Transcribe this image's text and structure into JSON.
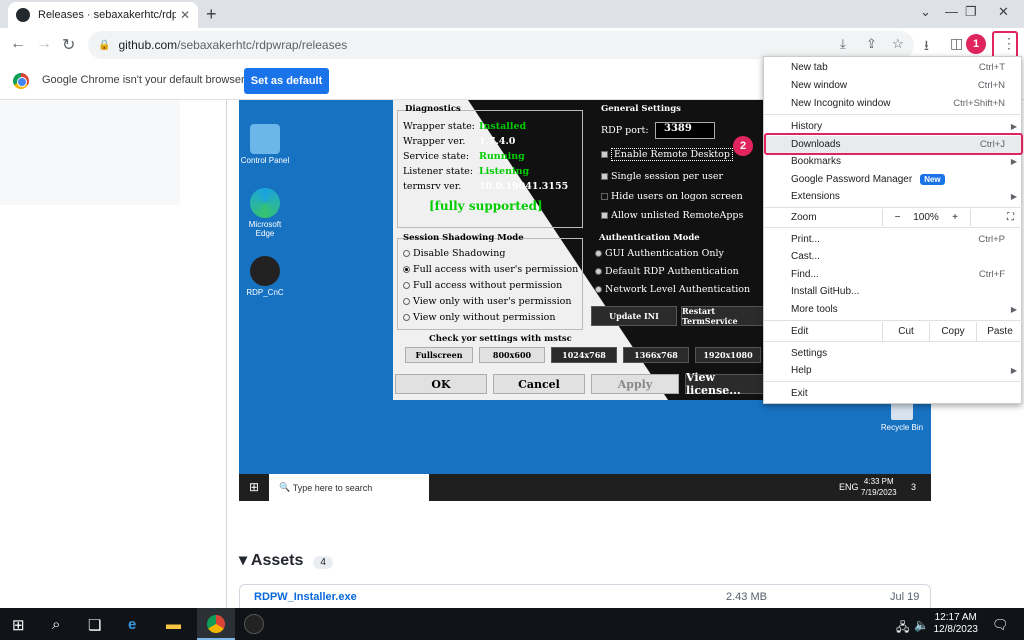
{
  "tab": {
    "title": "Releases · sebaxakerhtc/rdpwrap",
    "close": "✕"
  },
  "omnibox": {
    "host": "github.com",
    "path": "/sebaxakerhtc/rdpwrap/releases"
  },
  "infobar": {
    "message": "Google Chrome isn't your default browser",
    "button": "Set as default"
  },
  "markers": {
    "one": "1",
    "two": "2"
  },
  "desktop": {
    "icons": [
      "Control Panel",
      "Microsoft Edge",
      "RDP_CnC"
    ],
    "recycle": "Recycle Bin",
    "search_placeholder": "Type here to search",
    "lang": "ENG",
    "time": "4:33 PM",
    "date": "7/19/2023",
    "notif": "3"
  },
  "dialog": {
    "diag_title": "Diagnostics",
    "wrapper_state_label": "Wrapper state:",
    "wrapper_state": "Installed",
    "wrapper_ver_label": "Wrapper ver.",
    "wrapper_ver": "1.7.4.0",
    "service_state_label": "Service state:",
    "service_state": "Running",
    "listener_state_label": "Listener state:",
    "listener_state": "Listening",
    "termsrv_label": "termsrv ver.",
    "termsrv": "10.0.19041.3155",
    "supported": "[fully supported]",
    "general_title": "General Settings",
    "rdp_port_label": "RDP port:",
    "rdp_port": "3389",
    "enable_remote": "Enable Remote Desktop",
    "single_session": "Single session per user",
    "hide_users": "Hide users on logon screen",
    "allow_unlisted": "Allow unlisted RemoteApps",
    "shadow_title": "Session Shadowing Mode",
    "shadow_opts": [
      "Disable Shadowing",
      "Full access with user's permission",
      "Full access without permission",
      "View only with user's permission",
      "View only without permission"
    ],
    "auth_title": "Authentication Mode",
    "auth_opts": [
      "GUI Authentication Only",
      "Default RDP Authentication",
      "Network Level Authentication"
    ],
    "update_ini": "Update INI",
    "restart": "Restart TermService",
    "check_title": "Check yor settings with mstsc",
    "resolutions": [
      "Fullscreen",
      "800x600",
      "1024x768",
      "1366x768",
      "1920x1080"
    ],
    "ok": "OK",
    "cancel": "Cancel",
    "apply": "Apply",
    "license": "View license..."
  },
  "assets": {
    "title": "Assets",
    "count": "4",
    "row_name": "RDPW_Installer.exe",
    "row_size": "2.43 MB",
    "row_date": "Jul 19"
  },
  "menu": {
    "new_tab": "New tab",
    "new_tab_sc": "Ctrl+T",
    "new_window": "New window",
    "new_window_sc": "Ctrl+N",
    "incognito": "New Incognito window",
    "incognito_sc": "Ctrl+Shift+N",
    "history": "History",
    "downloads": "Downloads",
    "downloads_sc": "Ctrl+J",
    "bookmarks": "Bookmarks",
    "password_manager": "Google Password Manager",
    "new_badge": "New",
    "extensions": "Extensions",
    "zoom": "Zoom",
    "zoom_minus": "−",
    "zoom_value": "100%",
    "zoom_plus": "+",
    "print": "Print...",
    "print_sc": "Ctrl+P",
    "cast": "Cast...",
    "find": "Find...",
    "find_sc": "Ctrl+F",
    "install": "Install GitHub...",
    "more_tools": "More tools",
    "edit": "Edit",
    "cut": "Cut",
    "copy": "Copy",
    "paste": "Paste",
    "settings": "Settings",
    "help": "Help",
    "exit": "Exit"
  },
  "taskbar": {
    "time": "12:17 AM",
    "date": "12/8/2023"
  },
  "colors": {
    "accent": "#1a73e8",
    "highlight": "#e0245e",
    "green": "#00cc00"
  }
}
